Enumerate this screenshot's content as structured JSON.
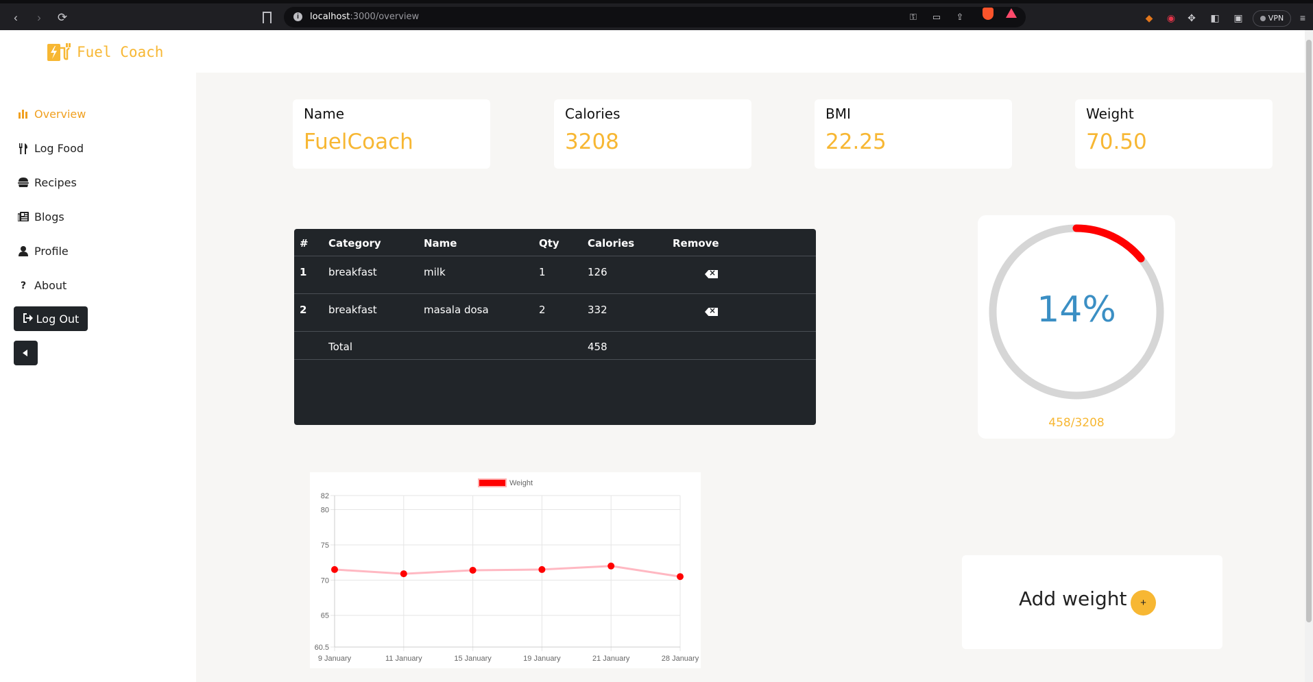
{
  "browser": {
    "url_host": "localhost",
    "url_path": ":3000/overview",
    "vpn_label": "VPN"
  },
  "app": {
    "name": "Fuel Coach",
    "accent": "#f7b733"
  },
  "sidebar": {
    "items": [
      {
        "label": "Overview",
        "icon": "bar-chart-icon",
        "active": true
      },
      {
        "label": "Log Food",
        "icon": "utensils-icon",
        "active": false
      },
      {
        "label": "Recipes",
        "icon": "burger-icon",
        "active": false
      },
      {
        "label": "Blogs",
        "icon": "newspaper-icon",
        "active": false
      },
      {
        "label": "Profile",
        "icon": "user-icon",
        "active": false
      },
      {
        "label": "About",
        "icon": "question-icon",
        "active": false
      }
    ],
    "logout_label": "Log Out"
  },
  "stats": [
    {
      "label": "Name",
      "value": "FuelCoach"
    },
    {
      "label": "Calories",
      "value": "3208"
    },
    {
      "label": "BMI",
      "value": "22.25"
    },
    {
      "label": "Weight",
      "value": "70.50"
    }
  ],
  "food_table": {
    "headers": [
      "#",
      "Category",
      "Name",
      "Qty",
      "Calories",
      "Remove"
    ],
    "rows": [
      {
        "num": "1",
        "category": "breakfast",
        "name": "milk",
        "qty": "1",
        "calories": "126"
      },
      {
        "num": "2",
        "category": "breakfast",
        "name": "masala dosa",
        "qty": "2",
        "calories": "332"
      }
    ],
    "total_label": "Total",
    "total_calories": "458"
  },
  "progress": {
    "percent_label": "14%",
    "fraction": 0.14,
    "ratio_label": "458/3208"
  },
  "chart_data": {
    "type": "line",
    "legend": [
      "Weight"
    ],
    "legend_position": "top",
    "categories": [
      "9 January",
      "11 January",
      "15 January",
      "19 January",
      "21 January",
      "28 January"
    ],
    "series": [
      {
        "name": "Weight",
        "values": [
          71.5,
          70.9,
          71.4,
          71.5,
          72.0,
          70.5
        ],
        "color": "#ff0000"
      }
    ],
    "ylim": [
      60.5,
      82
    ],
    "yticks": [
      "82",
      "80",
      "75",
      "70",
      "65",
      "60.5"
    ],
    "grid": true
  },
  "weight_card": {
    "label": "Add weight",
    "button": "+"
  }
}
